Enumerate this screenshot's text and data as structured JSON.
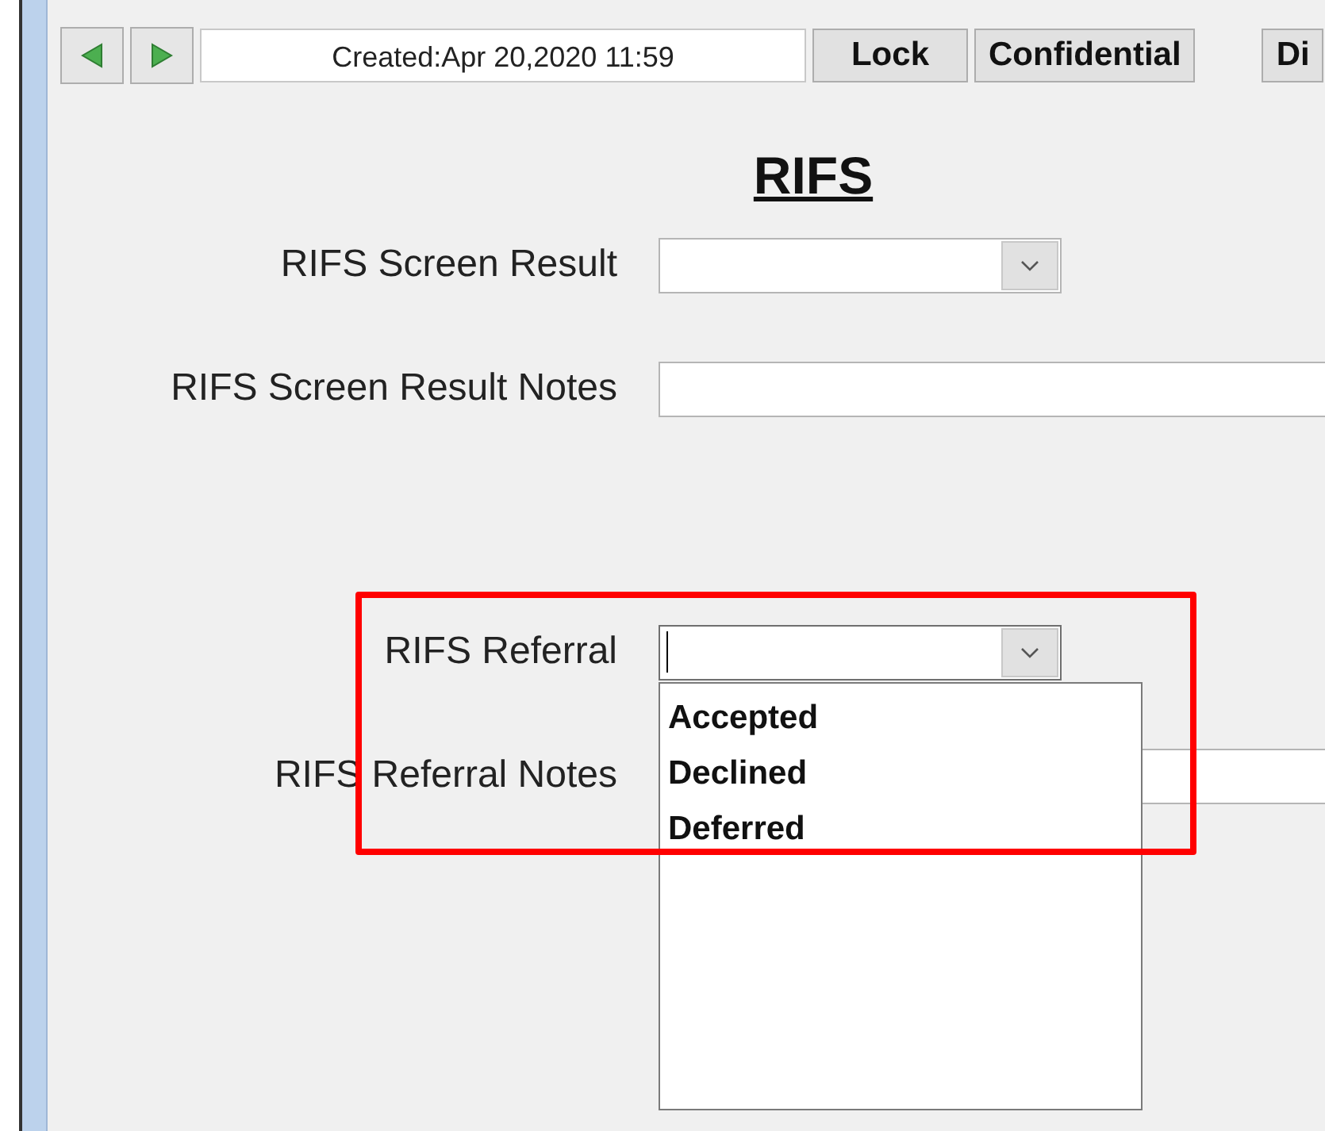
{
  "toolbar": {
    "created": "Created:Apr 20,2020 11:59",
    "buttons": [
      "Lock",
      "Confidential",
      "Di"
    ]
  },
  "form": {
    "title": "RIFS",
    "fields": [
      {
        "kind": "combo",
        "label": "RIFS Screen Result",
        "expanded": false
      },
      {
        "kind": "text",
        "label": "RIFS Screen Result Notes"
      },
      {
        "kind": "spacer"
      },
      {
        "kind": "combo",
        "label": "RIFS Referral",
        "expanded": true,
        "options": [
          "Accepted",
          "Declined",
          "Deferred"
        ]
      },
      {
        "kind": "text",
        "label": "RIFS Referral Notes"
      }
    ]
  },
  "highlight": {
    "shown": true
  }
}
